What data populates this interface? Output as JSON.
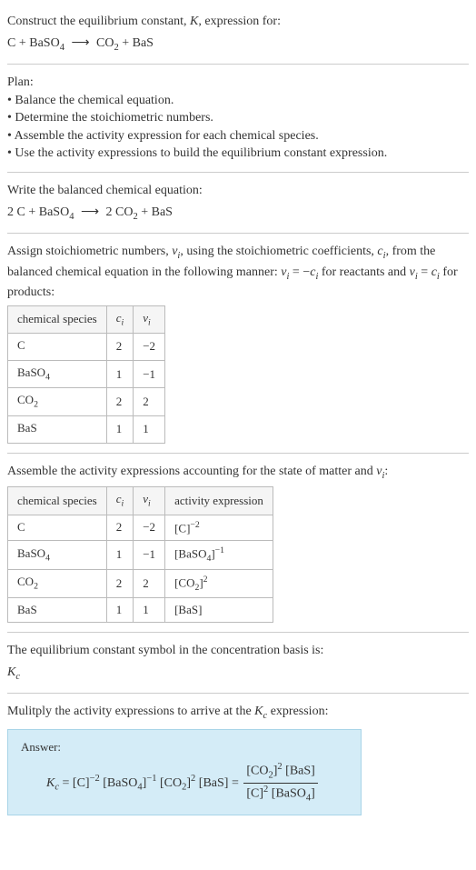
{
  "intro": {
    "line1": "Construct the equilibrium constant, ",
    "k": "K",
    "line1b": ", expression for:",
    "eq_lhs": "C + BaSO",
    "eq_lhs_sub": "4",
    "arrow": "⟶",
    "eq_rhs_a": "CO",
    "eq_rhs_a_sub": "2",
    "eq_rhs_b": " + BaS"
  },
  "plan": {
    "title": "Plan:",
    "b1": "• Balance the chemical equation.",
    "b2": "• Determine the stoichiometric numbers.",
    "b3": "• Assemble the activity expression for each chemical species.",
    "b4": "• Use the activity expressions to build the equilibrium constant expression."
  },
  "balanced": {
    "title": "Write the balanced chemical equation:",
    "lhs_a": "2 C + BaSO",
    "lhs_a_sub": "4",
    "arrow": "⟶",
    "rhs_a": "2 CO",
    "rhs_a_sub": "2",
    "rhs_b": " + BaS"
  },
  "assign": {
    "text_a": "Assign stoichiometric numbers, ",
    "nu_i": "ν",
    "i_sub": "i",
    "text_b": ", using the stoichiometric coefficients, ",
    "c_i": "c",
    "text_c": ", from the balanced chemical equation in the following manner: ",
    "rel1_a": "ν",
    "rel1_b": " = −",
    "rel1_c": "c",
    "text_d": " for reactants and ",
    "rel2_a": "ν",
    "rel2_b": " = ",
    "rel2_c": "c",
    "text_e": " for products:"
  },
  "table1": {
    "h1": "chemical species",
    "h2": "c",
    "h2_sub": "i",
    "h3": "ν",
    "h3_sub": "i",
    "rows": [
      {
        "sp": "C",
        "sp_sub": "",
        "c": "2",
        "nu": "−2"
      },
      {
        "sp": "BaSO",
        "sp_sub": "4",
        "c": "1",
        "nu": "−1"
      },
      {
        "sp": "CO",
        "sp_sub": "2",
        "c": "2",
        "nu": "2"
      },
      {
        "sp": "BaS",
        "sp_sub": "",
        "c": "1",
        "nu": "1"
      }
    ]
  },
  "assemble": {
    "text_a": "Assemble the activity expressions accounting for the state of matter and ",
    "nu": "ν",
    "i_sub": "i",
    "text_b": ":"
  },
  "table2": {
    "h1": "chemical species",
    "h2": "c",
    "h2_sub": "i",
    "h3": "ν",
    "h3_sub": "i",
    "h4": "activity expression",
    "rows": [
      {
        "sp": "C",
        "sp_sub": "",
        "c": "2",
        "nu": "−2",
        "act_base": "[C]",
        "act_exp": "−2"
      },
      {
        "sp": "BaSO",
        "sp_sub": "4",
        "c": "1",
        "nu": "−1",
        "act_base": "[BaSO",
        "act_base_sub": "4",
        "act_base_close": "]",
        "act_exp": "−1"
      },
      {
        "sp": "CO",
        "sp_sub": "2",
        "c": "2",
        "nu": "2",
        "act_base": "[CO",
        "act_base_sub": "2",
        "act_base_close": "]",
        "act_exp": "2"
      },
      {
        "sp": "BaS",
        "sp_sub": "",
        "c": "1",
        "nu": "1",
        "act_base": "[BaS]",
        "act_exp": ""
      }
    ]
  },
  "symbol": {
    "text": "The equilibrium constant symbol in the concentration basis is:",
    "k": "K",
    "ksub": "c"
  },
  "mult": {
    "text_a": "Mulitply the activity expressions to arrive at the ",
    "k": "K",
    "ksub": "c",
    "text_b": " expression:"
  },
  "answer": {
    "label": "Answer:",
    "kc_k": "K",
    "kc_sub": "c",
    "eq": " = ",
    "t1": "[C]",
    "t1_exp": "−2",
    "sp": " ",
    "t2a": "[BaSO",
    "t2sub": "4",
    "t2b": "]",
    "t2_exp": "−1",
    "t3a": "[CO",
    "t3sub": "2",
    "t3b": "]",
    "t3_exp": "2",
    "t4": "[BaS]",
    "eq2": " = ",
    "num_a": "[CO",
    "num_a_sub": "2",
    "num_b": "]",
    "num_exp": "2",
    "num_c": " [BaS]",
    "den_a": "[C]",
    "den_a_exp": "2",
    "den_b": " [BaSO",
    "den_b_sub": "4",
    "den_c": "]"
  }
}
